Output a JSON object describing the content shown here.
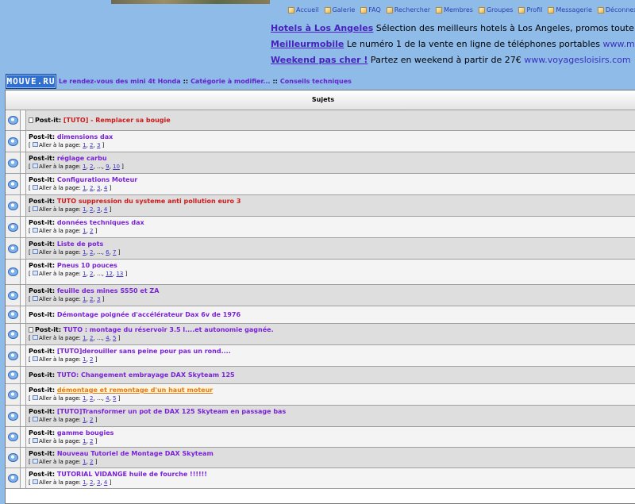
{
  "nav": [
    {
      "label": "Accueil",
      "icon": "home-icon"
    },
    {
      "label": "Galerie",
      "icon": "gallery-icon"
    },
    {
      "label": "FAQ",
      "icon": "faq-icon"
    },
    {
      "label": "Rechercher",
      "icon": "search-icon"
    },
    {
      "label": "Membres",
      "icon": "members-icon"
    },
    {
      "label": "Groupes",
      "icon": "groups-icon"
    },
    {
      "label": "Profil",
      "icon": "profile-icon"
    },
    {
      "label": "Messagerie",
      "icon": "message-icon"
    },
    {
      "label": "Déconnexion",
      "icon": "logout-icon"
    }
  ],
  "ads": [
    {
      "title": "Hotels à Los Angeles",
      "text": " Sélection des meilleurs hotels à Los Angeles, promos toute l'année ! t",
      "url": ""
    },
    {
      "title": "Meilleurmobile",
      "text": " Le numéro 1 de la vente en ligne de téléphones portables ",
      "url": "www.meilleurmobi"
    },
    {
      "title": "Weekend pas cher !",
      "text": " Partez en weekend à partir de 27€ ",
      "url": "www.voyagesloisirs.com"
    }
  ],
  "breadcrumb": {
    "logo": "MOUVE.RU",
    "items": [
      "Le rendez-vous des mini 4t Honda",
      "Catégorie à modifier...",
      "Conseils techniques"
    ],
    "separator": "::"
  },
  "table": {
    "header": "Sujets",
    "prefix": "Post-it:",
    "goto_label": "Aller à la page:",
    "rows": [
      {
        "title": "[TUTO] - Remplacer sa bougie",
        "red": true,
        "doc": true,
        "pages": []
      },
      {
        "title": "dimensions dax",
        "pages": [
          "1",
          "2",
          "3"
        ]
      },
      {
        "title": "réglage carbu",
        "pages": [
          "1",
          "2",
          "...",
          "9",
          "10"
        ]
      },
      {
        "title": "Configurations Moteur",
        "pages": [
          "1",
          "2",
          "3",
          "4"
        ]
      },
      {
        "title": "TUTO suppression du systeme anti pollution euro 3",
        "red": true,
        "pages": [
          "1",
          "2",
          "3",
          "4"
        ]
      },
      {
        "title": "données techniques dax",
        "pages": [
          "1",
          "2"
        ]
      },
      {
        "title": "Liste de pots",
        "pages": [
          "1",
          "2",
          "...",
          "6",
          "7"
        ]
      },
      {
        "title": "Pneus 10 pouces",
        "pages": [
          "1",
          "2",
          "...",
          "12",
          "13"
        ]
      },
      {
        "title": "feuille des mines SS50 et ZA",
        "pages": [
          "1",
          "2",
          "3"
        ]
      },
      {
        "title": "Démontage poignée d'accélérateur Dax 6v de 1976",
        "pages": []
      },
      {
        "title": "TUTO : montage du réservoir 3.5 l....et autonomie gagnée.",
        "doc": true,
        "pages": [
          "1",
          "2",
          "...",
          "4",
          "5"
        ]
      },
      {
        "title": "[TUTO]derouiller sans peine pour pas un rond....",
        "pages": [
          "1",
          "2"
        ]
      },
      {
        "title": "TUTO: Changement embrayage DAX Skyteam 125",
        "pages": []
      },
      {
        "title": "démontage et remontage d'un haut moteur",
        "highlight": true,
        "pages": [
          "1",
          "2",
          "...",
          "4",
          "5"
        ]
      },
      {
        "title": "[TUTO]Transformer un pot de DAX 125 Skyteam en passage bas",
        "pages": [
          "1",
          "2"
        ]
      },
      {
        "title": "gamme bougies",
        "pages": [
          "1",
          "2"
        ]
      },
      {
        "title": "Nouveau Tutoriel de Montage DAX Skyteam",
        "pages": [
          "1",
          "2"
        ]
      },
      {
        "title": "TUTORIAL VIDANGE huile de fourche !!!!!!",
        "pages": [
          "1",
          "2",
          "3",
          "4"
        ]
      }
    ]
  }
}
